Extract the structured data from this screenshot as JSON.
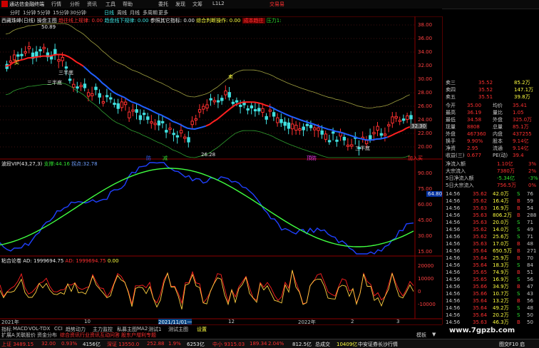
{
  "titlebar": {
    "app": "通达信金融终端",
    "menus": [
      "行情",
      "分析",
      "资讯",
      "工具",
      "帮助"
    ],
    "mid": [
      "委托",
      "发现",
      "文筹",
      "L1L2"
    ],
    "trade": "交易易"
  },
  "tabbar": {
    "periods": [
      "分时",
      "1分钟",
      "5分钟",
      "15分钟",
      "30分钟",
      "日线",
      "周线",
      "月线",
      "多周期",
      "更多"
    ]
  },
  "main": {
    "stock": "西藏珠峰(日线)",
    "overlay_name": "操盘主图",
    "ind1": "趋往线上规律: 0.00",
    "ind2": "趋盘线下规律: 0.00",
    "ind3": "参照其它指标: 0.00",
    "ind4": "综合判断操作: 0.00",
    "ind5": "成本趋往",
    "ind6": "压力1:",
    "high_label": "50.89",
    "low_label": "26.28",
    "last_price_label": "32.30",
    "buy_sign": "买",
    "sell_sign": "卖",
    "bottom_label": "三半底",
    "bottom_label2": "三半底",
    "bottom_label3": "三半底",
    "buy_seg": "防",
    "sell_seg": "减",
    "zhuijia": "加入买",
    "cancel_label": "顶防"
  },
  "osc": {
    "name": "波段VIP(43,27,3)",
    "label1": "支撑:44.16",
    "label2": "拐点:32.78",
    "right_label": "64.80"
  },
  "ad": {
    "name": "粘合论卷 AD: 1999694.75",
    "label1": "AD: 1999694.75",
    "label2": "0.00"
  },
  "axis": {
    "main_ticks": [
      "38.00",
      "36.00",
      "34.00",
      "32.00",
      "30.00",
      "28.00",
      "26.00",
      "24.00",
      "22.00",
      "20.00"
    ],
    "osc_ticks": [
      "90.00",
      "75.00",
      "60.00",
      "45.00",
      "30.00",
      "15.00"
    ],
    "ad_ticks": [
      "20000",
      "10000",
      "0",
      "-10000"
    ]
  },
  "xaxis": {
    "labels": [
      "2021年",
      "10",
      "2021/11/01一",
      "12",
      "2022年",
      "2",
      "3"
    ]
  },
  "quote": {
    "sell_rows": [
      {
        "label": "卖三",
        "price": "35.52",
        "vol": "85.2万"
      },
      {
        "label": "卖四",
        "price": "35.52",
        "vol": "147.1万"
      },
      {
        "label": "卖五",
        "price": "35.51",
        "vol": "39.8万"
      }
    ],
    "fields": [
      {
        "l": "今开",
        "v": "35.00",
        "l2": "均价",
        "v2": "35.41"
      },
      {
        "l": "最高",
        "v": "36.19",
        "l2": "量比",
        "v2": "1.05"
      },
      {
        "l": "最低",
        "v": "34.58",
        "l2": "外盘",
        "v2": "325.0万"
      },
      {
        "l": "现量",
        "v": "8808",
        "l2": "总量",
        "v2": "85.1万"
      },
      {
        "l": "外盘",
        "v": "467360",
        "l2": "内盘",
        "v2": "437255"
      },
      {
        "l": "换手",
        "v": "9.90%",
        "l2": "股本",
        "v2": "9.14亿"
      },
      {
        "l": "净资",
        "v": "2.95",
        "l2": "流通",
        "v2": "9.14亿"
      },
      {
        "l": "收益(三)",
        "v": "0.677",
        "l2": "PE(动)",
        "v2": "39.4"
      }
    ],
    "flow": [
      {
        "l": "净流入额",
        "v": "1.10亿",
        "c": "3%"
      },
      {
        "l": "大宗流入",
        "v": "7380万",
        "c": "2%"
      },
      {
        "l": "5日净流入额",
        "v": "-5.34亿",
        "c": "-3%"
      },
      {
        "l": "5日大宗流入",
        "v": "756.5万",
        "c": "0%"
      }
    ],
    "ticks": [
      {
        "t": "14:56",
        "p": "35.62",
        "v": "42.0万",
        "s": "S",
        "n": "76"
      },
      {
        "t": "14:56",
        "p": "35.62",
        "v": "16.4万",
        "s": "B",
        "n": "59"
      },
      {
        "t": "14:56",
        "p": "35.63",
        "v": "16.9万",
        "s": "B",
        "n": "54"
      },
      {
        "t": "14:56",
        "p": "35.63",
        "v": "806.2万",
        "s": "B",
        "n": "288"
      },
      {
        "t": "14:56",
        "p": "35.63",
        "v": "20.0万",
        "s": "S",
        "n": "71"
      },
      {
        "t": "14:56",
        "p": "35.62",
        "v": "14.0万",
        "s": "S",
        "n": "49"
      },
      {
        "t": "14:56",
        "p": "35.62",
        "v": "25.6万",
        "s": "S",
        "n": "71"
      },
      {
        "t": "14:56",
        "p": "35.63",
        "v": "17.0万",
        "s": "B",
        "n": "48"
      },
      {
        "t": "14:56",
        "p": "35.64",
        "v": "650.5万",
        "s": "B",
        "n": "271"
      },
      {
        "t": "14:56",
        "p": "35.64",
        "v": "25.9万",
        "s": "B",
        "n": "70"
      },
      {
        "t": "14:56",
        "p": "35.64",
        "v": "18.3万",
        "s": "S",
        "n": "84"
      },
      {
        "t": "14:56",
        "p": "35.65",
        "v": "74.9万",
        "s": "B",
        "n": "51"
      },
      {
        "t": "14:56",
        "p": "35.65",
        "v": "16.9万",
        "s": "S",
        "n": "56"
      },
      {
        "t": "14:56",
        "p": "35.66",
        "v": "34.9万",
        "s": "B",
        "n": "47"
      },
      {
        "t": "14:56",
        "p": "35.66",
        "v": "10.7万",
        "s": "S",
        "n": "43"
      },
      {
        "t": "14:56",
        "p": "35.64",
        "v": "13.2万",
        "s": "B",
        "n": "56"
      },
      {
        "t": "14:56",
        "p": "35.64",
        "v": "49.2万",
        "s": "S",
        "n": "48"
      },
      {
        "t": "14:56",
        "p": "35.64",
        "v": "20.2万",
        "s": "S",
        "n": "50"
      },
      {
        "t": "14:56",
        "p": "35.63",
        "v": "46.3万",
        "s": "B",
        "n": "50"
      }
    ]
  },
  "fnbar": {
    "items": [
      "指标",
      "MACD",
      "VOL-TDX",
      "CCI",
      "趋势动力",
      "主力监控",
      "私募主图",
      "MA2",
      "测试1",
      "测试主图",
      "设置"
    ]
  },
  "fnbar2": {
    "items": [
      "扩展A",
      "关联股价",
      "资金分布",
      "综合资讯",
      "行业资讯",
      "互动问答",
      "股东户增利专题"
    ],
    "right": [
      "模板",
      "▼"
    ]
  },
  "watermark": {
    "text": "www.7gpzb.com"
  },
  "status": {
    "items": [
      "上证 3489.15",
      "32.00",
      "0.93%",
      "4156亿",
      "深证 13550.0",
      "252.88",
      "1.9%",
      "6253亿",
      "中小 9315.03",
      "189.34",
      "2.04%",
      "812.5亿",
      "总成交",
      "10409亿",
      "中安证券长沙行情"
    ],
    "right": "图交F10 启"
  }
}
